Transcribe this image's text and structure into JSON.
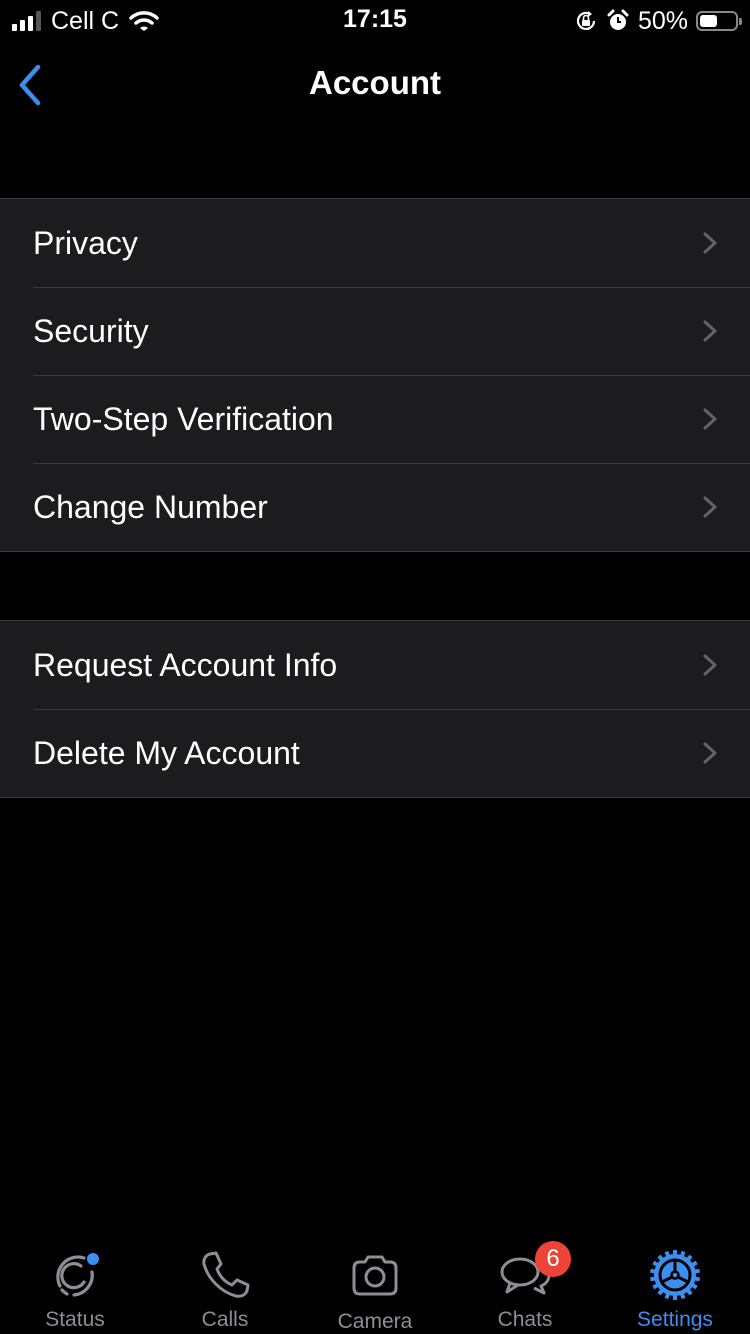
{
  "status_bar": {
    "carrier": "Cell C",
    "time": "17:15",
    "battery_percent": "50%",
    "battery_level": 0.5,
    "signal_bars_active": 3,
    "signal_bars_total": 4,
    "icons": [
      "signal-icon",
      "wifi-icon",
      "orientation-lock-icon",
      "alarm-icon",
      "battery-icon"
    ]
  },
  "nav": {
    "title": "Account",
    "back_icon": "chevron-left-icon"
  },
  "groups": [
    {
      "items": [
        {
          "label": "Privacy"
        },
        {
          "label": "Security"
        },
        {
          "label": "Two-Step Verification"
        },
        {
          "label": "Change Number"
        }
      ]
    },
    {
      "items": [
        {
          "label": "Request Account Info"
        },
        {
          "label": "Delete My Account"
        }
      ]
    }
  ],
  "tab_bar": {
    "tabs": [
      {
        "label": "Status",
        "icon": "status-icon",
        "active": false,
        "has_dot": true
      },
      {
        "label": "Calls",
        "icon": "phone-icon",
        "active": false
      },
      {
        "label": "Camera",
        "icon": "camera-icon",
        "active": false
      },
      {
        "label": "Chats",
        "icon": "chat-bubbles-icon",
        "active": false,
        "badge": "6"
      },
      {
        "label": "Settings",
        "icon": "gear-icon",
        "active": true
      }
    ]
  },
  "colors": {
    "accent": "#3a8ff0",
    "badge": "#ee4437",
    "cell_background": "#1c1c1e",
    "inactive_tab": "#8e8e93"
  }
}
